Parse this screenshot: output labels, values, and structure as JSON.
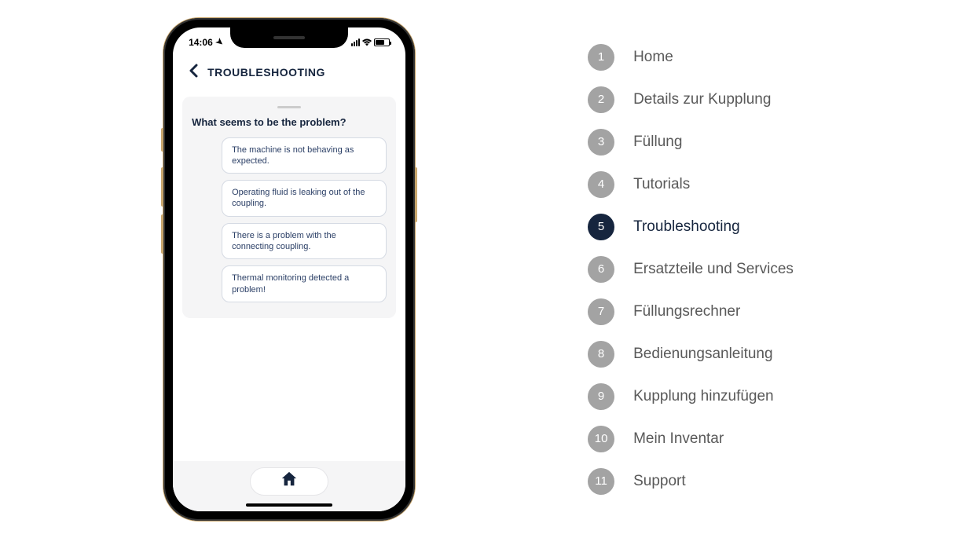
{
  "status_bar": {
    "time": "14:06"
  },
  "app_header": {
    "title": "TROUBLESHOOTING"
  },
  "card": {
    "question": "What seems to be the problem?",
    "options": [
      "The machine is not behaving as expected.",
      "Operating fluid is leaking out of the coupling.",
      "There is a problem with the connecting coupling.",
      "Thermal monitoring detected a problem!"
    ]
  },
  "legend": {
    "active_index": 4,
    "items": [
      {
        "num": "1",
        "label": "Home"
      },
      {
        "num": "2",
        "label": "Details zur Kupplung"
      },
      {
        "num": "3",
        "label": "Füllung"
      },
      {
        "num": "4",
        "label": "Tutorials"
      },
      {
        "num": "5",
        "label": "Troubleshooting"
      },
      {
        "num": "6",
        "label": "Ersatzteile und Services"
      },
      {
        "num": "7",
        "label": "Füllungsrechner"
      },
      {
        "num": "8",
        "label": "Bedienungsanleitung"
      },
      {
        "num": "9",
        "label": "Kupplung hinzufügen"
      },
      {
        "num": "10",
        "label": "Mein Inventar"
      },
      {
        "num": "11",
        "label": "Support"
      }
    ]
  }
}
